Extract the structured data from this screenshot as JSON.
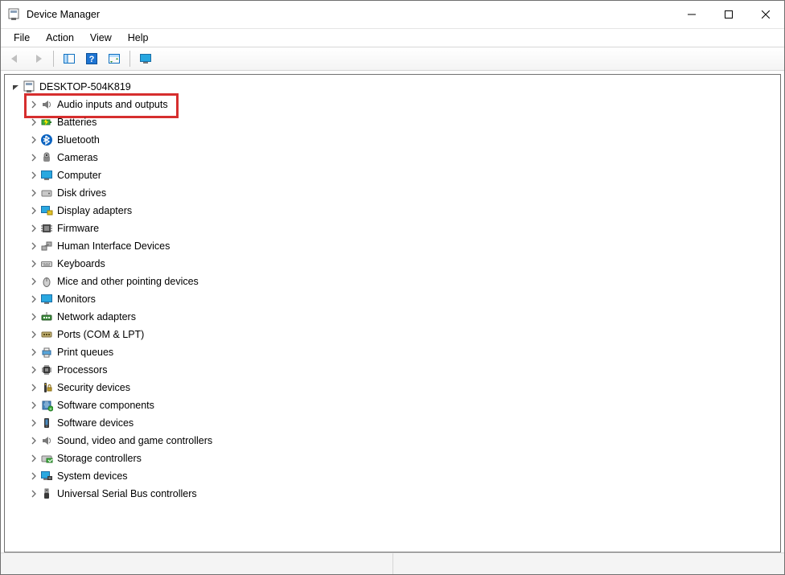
{
  "window": {
    "title": "Device Manager"
  },
  "menubar": {
    "file": "File",
    "action": "Action",
    "view": "View",
    "help": "Help"
  },
  "tree": {
    "root": "DESKTOP-504K819",
    "items": [
      {
        "id": "audio",
        "label": "Audio inputs and outputs",
        "icon": "speaker-icon",
        "highlighted": true
      },
      {
        "id": "batteries",
        "label": "Batteries",
        "icon": "battery-icon"
      },
      {
        "id": "bluetooth",
        "label": "Bluetooth",
        "icon": "bluetooth-icon"
      },
      {
        "id": "cameras",
        "label": "Cameras",
        "icon": "camera-icon"
      },
      {
        "id": "computer",
        "label": "Computer",
        "icon": "monitor-icon"
      },
      {
        "id": "diskdrives",
        "label": "Disk drives",
        "icon": "disk-icon"
      },
      {
        "id": "display",
        "label": "Display adapters",
        "icon": "display-adapter-icon"
      },
      {
        "id": "firmware",
        "label": "Firmware",
        "icon": "firmware-icon"
      },
      {
        "id": "hid",
        "label": "Human Interface Devices",
        "icon": "hid-icon"
      },
      {
        "id": "keyboards",
        "label": "Keyboards",
        "icon": "keyboard-icon"
      },
      {
        "id": "mice",
        "label": "Mice and other pointing devices",
        "icon": "mouse-icon"
      },
      {
        "id": "monitors",
        "label": "Monitors",
        "icon": "monitor-icon"
      },
      {
        "id": "network",
        "label": "Network adapters",
        "icon": "network-icon"
      },
      {
        "id": "ports",
        "label": "Ports (COM & LPT)",
        "icon": "port-icon"
      },
      {
        "id": "printqueues",
        "label": "Print queues",
        "icon": "printer-icon"
      },
      {
        "id": "processors",
        "label": "Processors",
        "icon": "processor-icon"
      },
      {
        "id": "security",
        "label": "Security devices",
        "icon": "security-icon"
      },
      {
        "id": "swcomp",
        "label": "Software components",
        "icon": "software-component-icon"
      },
      {
        "id": "swdev",
        "label": "Software devices",
        "icon": "software-device-icon"
      },
      {
        "id": "sound",
        "label": "Sound, video and game controllers",
        "icon": "speaker-icon"
      },
      {
        "id": "storage",
        "label": "Storage controllers",
        "icon": "storage-controller-icon"
      },
      {
        "id": "system",
        "label": "System devices",
        "icon": "system-device-icon"
      },
      {
        "id": "usb",
        "label": "Universal Serial Bus controllers",
        "icon": "usb-icon"
      }
    ]
  },
  "highlight_color": "#d62e2e"
}
